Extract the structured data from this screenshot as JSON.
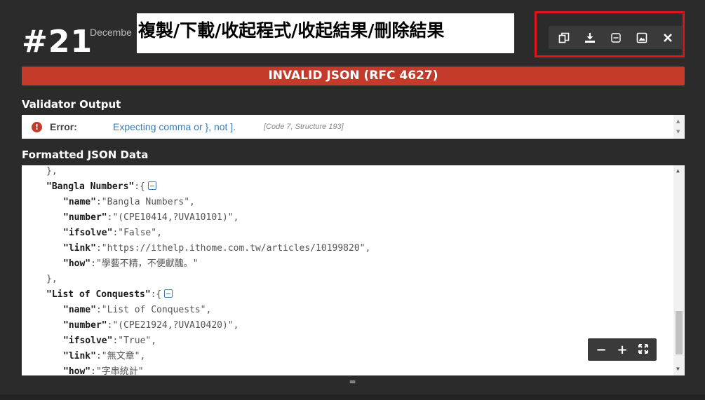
{
  "header": {
    "result_number": "#21",
    "date_text": "Decembe",
    "annotation_text": "複製/下載/收起程式/收起結果/刪除結果"
  },
  "toolbar": {
    "buttons": [
      {
        "icon": "copy-icon"
      },
      {
        "icon": "download-icon"
      },
      {
        "icon": "collapse-icon"
      },
      {
        "icon": "image-icon"
      },
      {
        "icon": "close-icon"
      }
    ]
  },
  "status": {
    "label": "INVALID JSON (RFC 4627)",
    "color": "#c43a2b"
  },
  "validator": {
    "title": "Validator Output",
    "error_icon": "!",
    "error_label": "Error:",
    "error_message": "Expecting comma or }, not ].",
    "error_code": "[Code 7, Structure 193]"
  },
  "formatted": {
    "title": "Formatted JSON Data",
    "lines": [
      {
        "indent": 1,
        "text": "},"
      },
      {
        "indent": 1,
        "key": "\"Bangla Numbers\"",
        "suffix": ":{",
        "collapse": true
      },
      {
        "indent": 2,
        "key": "\"name\"",
        "value": ":\"Bangla Numbers\","
      },
      {
        "indent": 2,
        "key": "\"number\"",
        "value": ":\"(CPE10414,?UVA10101)\","
      },
      {
        "indent": 2,
        "key": "\"ifsolve\"",
        "value": ":\"False\","
      },
      {
        "indent": 2,
        "key": "\"link\"",
        "value": ":\"https://ithelp.ithome.com.tw/articles/10199820\","
      },
      {
        "indent": 2,
        "key": "\"how\"",
        "value": ":\"學藝不精，不便獻醜。\""
      },
      {
        "indent": 1,
        "text": "},"
      },
      {
        "indent": 1,
        "key": "\"List of Conquests\"",
        "suffix": ":{",
        "collapse": true
      },
      {
        "indent": 2,
        "key": "\"name\"",
        "value": ":\"List of Conquests\","
      },
      {
        "indent": 2,
        "key": "\"number\"",
        "value": ":\"(CPE21924,?UVA10420)\","
      },
      {
        "indent": 2,
        "key": "\"ifsolve\"",
        "value": ":\"True\","
      },
      {
        "indent": 2,
        "key": "\"link\"",
        "value": ":\"無文章\","
      },
      {
        "indent": 2,
        "key": "\"how\"",
        "value": ":\"字串統計\""
      }
    ]
  },
  "zoom": {
    "minus": "−",
    "plus": "+",
    "fit": "⤢"
  },
  "resize_handle": "="
}
